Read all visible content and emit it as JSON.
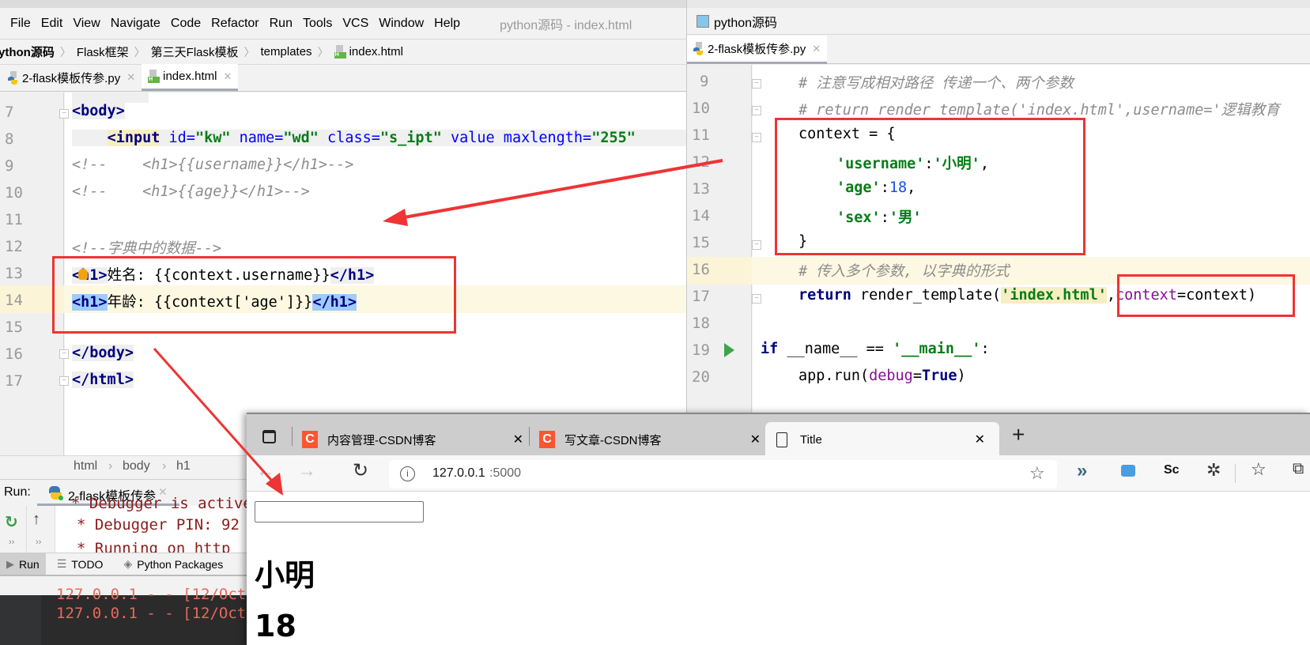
{
  "left_ide": {
    "menu": [
      "File",
      "Edit",
      "View",
      "Navigate",
      "Code",
      "Refactor",
      "Run",
      "Tools",
      "VCS",
      "Window",
      "Help"
    ],
    "window_caption": "python源码 - index.html",
    "breadcrumb": [
      "ython源码",
      "Flask框架",
      "第三天Flask模板",
      "templates",
      "index.html"
    ],
    "tabs": [
      {
        "label": "2-flask模板传参.py",
        "active": false
      },
      {
        "label": "index.html",
        "active": true
      }
    ],
    "line_numbers": [
      "7",
      "8",
      "9",
      "10",
      "11",
      "12",
      "13",
      "14",
      "15",
      "16",
      "17"
    ],
    "code": {
      "l7": "<body>",
      "l8_tag": "<input",
      "l8_rest_attr1": " id=",
      "l8_val1": "\"kw\"",
      "l8_attr2": " name=",
      "l8_val2": "\"wd\"",
      "l8_attr3": " class=",
      "l8_val3": "\"s_ipt\"",
      "l8_attr4": " value maxlength=",
      "l8_val4": "\"255\"",
      "l9": "<!--    <h1>{{username}}</h1>-->",
      "l10": "<!--    <h1>{{age}}</h1>-->",
      "l12": "<!--字典中的数据-->",
      "l13_open": "<h1>",
      "l13_text": "姓名: {{context.username}}",
      "l13_close": "</h1>",
      "l14_open": "<h1>",
      "l14_text": "年龄: {{context['age']}}",
      "l14_close": "</h1>",
      "l16": "</body>",
      "l17": "</html>"
    },
    "status_breadcrumb": [
      "html",
      "body",
      "h1"
    ],
    "run_panel": {
      "label": "Run:",
      "tab": "2-flask模板传参",
      "console_lines": [
        "* Debugger is active!",
        "* Debugger PIN: 92",
        "* Running on http"
      ]
    },
    "bottom_tools": [
      "Run",
      "TODO",
      "Python Packages"
    ],
    "terminal_lines": [
      "127.0.0.1 - - [12/Oct",
      "127.0.0.1 - - [12/Oct"
    ]
  },
  "right_ide": {
    "project": "python源码",
    "tab": "2-flask模板传参.py",
    "line_numbers": [
      "9",
      "10",
      "11",
      "12",
      "13",
      "14",
      "15",
      "16",
      "17",
      "18",
      "19",
      "20"
    ],
    "code": {
      "l9": "# 注意写成相对路径 传递一个、两个参数",
      "l10": "# return render_template('index.html',username='逻辑教育",
      "l11": "context = {",
      "l12_key": "'username'",
      "l12_val": "'小明'",
      "l13_key": "'age'",
      "l13_val": "18",
      "l14_key": "'sex'",
      "l14_val": "'男'",
      "l15": "}",
      "l16": "# 传入多个参数, 以字典的形式",
      "l17_kw": "return",
      "l17_fn": " render_template(",
      "l17_str": "'index.html'",
      "l17_param": "context",
      "l17_rest": "=context)",
      "l19_kw": "if",
      "l19_mid": " __name__ == ",
      "l19_str": "'__main__'",
      "l19_end": ":",
      "l20_a": "app.run(",
      "l20_param": "debug",
      "l20_eq": "=",
      "l20_true": "True",
      "l20_end": ")"
    }
  },
  "browser": {
    "tabs": [
      {
        "label": "内容管理-CSDN博客",
        "icon": "csdn-icon",
        "active": false
      },
      {
        "label": "写文章-CSDN博客",
        "icon": "csdn-icon",
        "active": false
      },
      {
        "label": "Title",
        "icon": "page-icon",
        "active": true
      }
    ],
    "url_host": "127.0.0.1",
    "url_port": ":5000",
    "toolbar_sc": "Sc",
    "page": {
      "input_value": "",
      "h1_name": "小明",
      "h1_age": "18"
    }
  },
  "annotation_color": "#ee3434"
}
